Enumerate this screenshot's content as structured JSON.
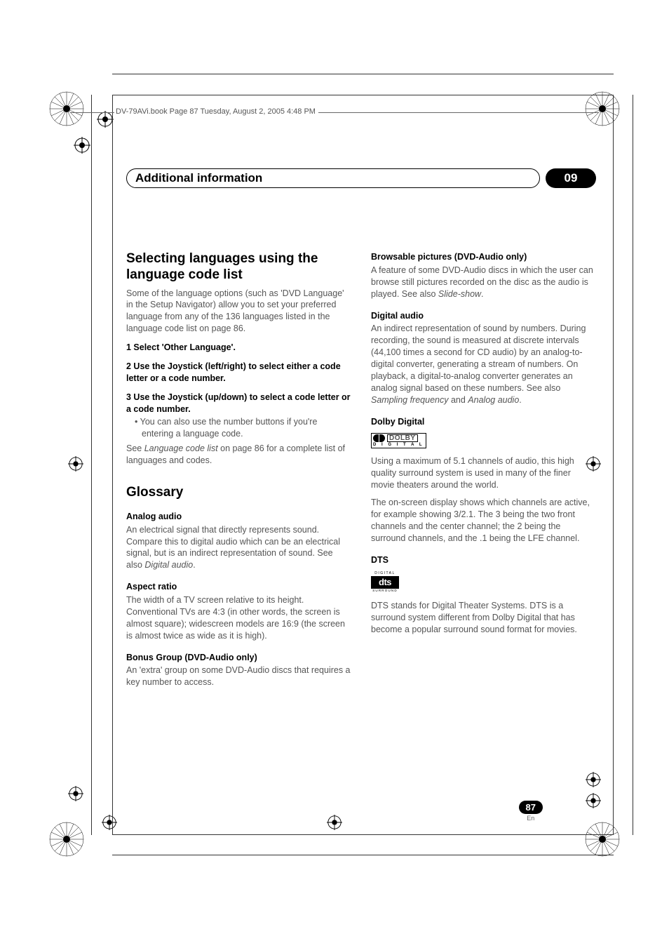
{
  "header": {
    "running": "DV-79AVi.book  Page 87  Tuesday, August 2, 2005  4:48 PM",
    "chapter_title": "Additional information",
    "chapter_number": "09"
  },
  "left": {
    "section1": {
      "title": "Selecting languages using the language code list",
      "intro": "Some of the language options (such as 'DVD Language' in the Setup Navigator) allow you to set your preferred language from any of the 136 languages listed in the language code list on page 86.",
      "step1": "1    Select 'Other Language'.",
      "step2": "2    Use the Joystick (left/right) to select either a code letter or a code number.",
      "step3": "3    Use the Joystick (up/down) to select a code letter or a code number.",
      "bullet": "You can also use the number buttons if you're entering a language code.",
      "see_pre": "See ",
      "see_em": "Language code list",
      "see_post": " on page 86 for a complete list of languages and codes."
    },
    "section2": {
      "title": "Glossary",
      "analog_h": "Analog audio",
      "analog_p_pre": "An electrical signal that directly represents sound. Compare this to digital audio which can be an electrical signal, but is an indirect representation of sound. See also ",
      "analog_p_em": "Digital audio",
      "analog_p_post": ".",
      "aspect_h": "Aspect ratio",
      "aspect_p": "The width of a TV screen relative to its height. Conventional TVs are 4:3 (in other words, the screen is almost square); widescreen models are 16:9 (the screen is almost twice as wide as it is high).",
      "bonus_h": "Bonus Group (DVD-Audio only)",
      "bonus_p": "An 'extra' group on some DVD-Audio discs that requires a key number to access."
    }
  },
  "right": {
    "brow_h": "Browsable pictures (DVD-Audio only)",
    "brow_p_pre": "A feature of some DVD-Audio discs in which the user can browse still pictures recorded on the disc as the audio is played. See also ",
    "brow_p_em": "Slide-show",
    "brow_p_post": ".",
    "digaudio_h": "Digital audio",
    "digaudio_p_pre": "An indirect representation of sound by numbers. During recording, the sound is measured at discrete intervals (44,100 times a second for CD audio) by an analog-to-digital converter, generating a stream of numbers. On playback, a digital-to-analog converter generates an analog signal based on these numbers. See also ",
    "digaudio_p_em1": "Sampling frequency",
    "digaudio_p_mid": " and ",
    "digaudio_p_em2": "Analog audio",
    "digaudio_p_post": ".",
    "dolby_h": "Dolby Digital",
    "dolby_word": "DOLBY",
    "dolby_sub": "D I G I T A L",
    "dolby_p1": "Using a maximum of 5.1 channels of audio, this high quality surround system is used in many of the finer movie theaters around the world.",
    "dolby_p2": "The on-screen display shows which channels are active, for example showing 3/2.1. The 3 being the two front channels and the center channel; the 2 being the surround channels, and the .1 being the LFE channel.",
    "dts_h": "DTS",
    "dts_dig": "DIGITAL",
    "dts_main": "dts",
    "dts_surr": "SURROUND",
    "dts_p": "DTS stands for Digital Theater Systems. DTS is a surround system different from Dolby Digital that has become a popular surround sound format for movies."
  },
  "footer": {
    "page": "87",
    "lang": "En"
  }
}
